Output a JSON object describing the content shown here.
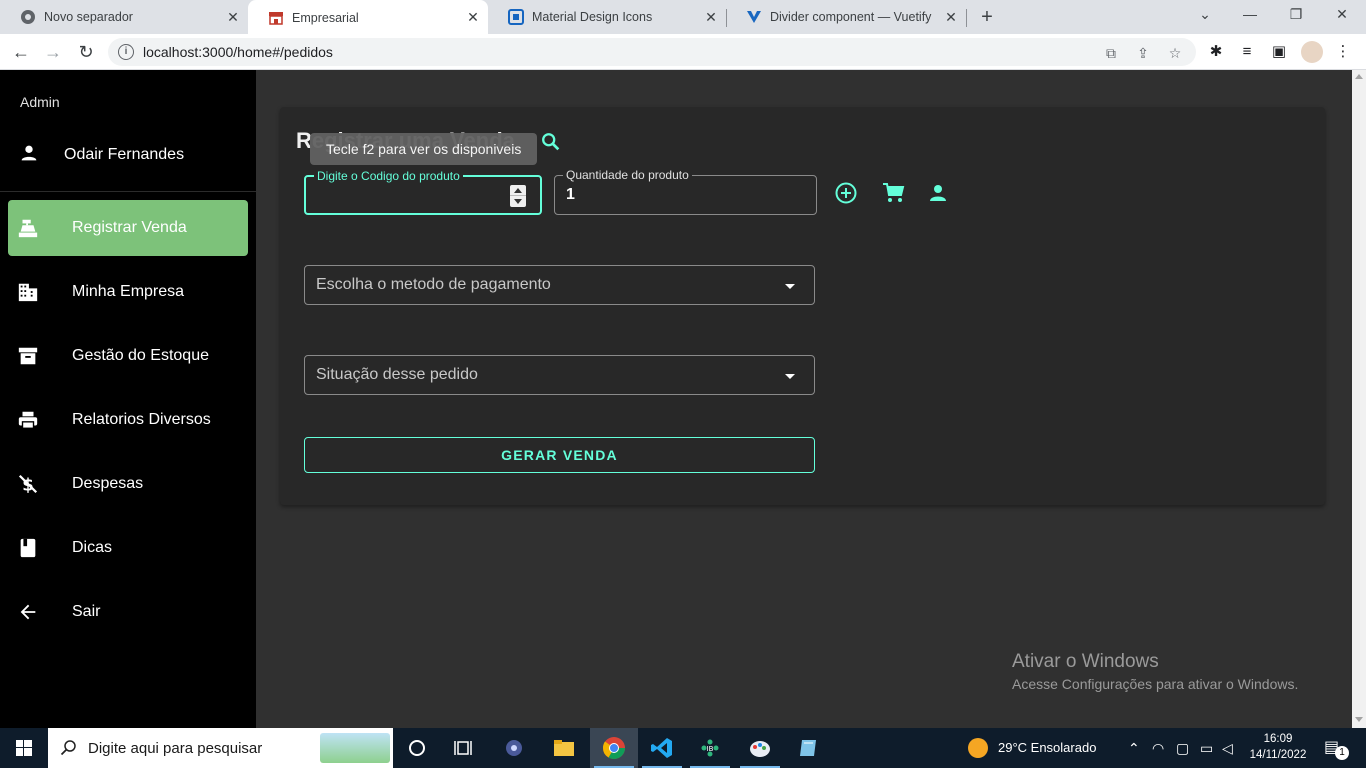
{
  "browser": {
    "tabs": [
      {
        "title": "Novo separador",
        "active": false
      },
      {
        "title": "Empresarial",
        "active": true
      },
      {
        "title": "Material Design Icons",
        "active": false
      },
      {
        "title": "Divider component — Vuetify",
        "active": false
      }
    ],
    "url": "localhost:3000/home#/pedidos"
  },
  "sidebar": {
    "header": "Admin",
    "user_name": "Odair Fernandes",
    "items": [
      {
        "label": "Registrar Venda",
        "icon": "cash-register-icon",
        "active": true
      },
      {
        "label": "Minha Empresa",
        "icon": "office-building-icon",
        "active": false
      },
      {
        "label": "Gestão do Estoque",
        "icon": "archive-icon",
        "active": false
      },
      {
        "label": "Relatorios Diversos",
        "icon": "printer-icon",
        "active": false
      },
      {
        "label": "Despesas",
        "icon": "currency-usd-off-icon",
        "active": false
      },
      {
        "label": "Dicas",
        "icon": "book-icon",
        "active": false
      },
      {
        "label": "Sair",
        "icon": "arrow-left-icon",
        "active": false
      }
    ]
  },
  "form": {
    "title": "Registrar uma Venda",
    "tooltip": "Tecle f2 para ver os disponiveis",
    "product_code": {
      "label": "Digite o Codigo do produto",
      "value": ""
    },
    "quantity": {
      "label": "Quantidade do produto",
      "value": "1"
    },
    "payment_method": {
      "placeholder": "Escolha o metodo de pagamento"
    },
    "order_status": {
      "placeholder": "Situação desse pedido"
    },
    "submit_label": "GERAR VENDA"
  },
  "watermark": {
    "title": "Ativar o Windows",
    "subtitle": "Acesse Configurações para ativar o Windows."
  },
  "taskbar": {
    "search_placeholder": "Digite aqui para pesquisar",
    "weather": "29°C  Ensolarado",
    "time": "16:09",
    "date": "14/11/2022",
    "notifications": "1"
  },
  "colors": {
    "accent": "#64ffda",
    "active_nav": "#7dc27a",
    "sidebar_bg": "#000000",
    "main_bg": "#303030",
    "card_bg": "#282828"
  }
}
